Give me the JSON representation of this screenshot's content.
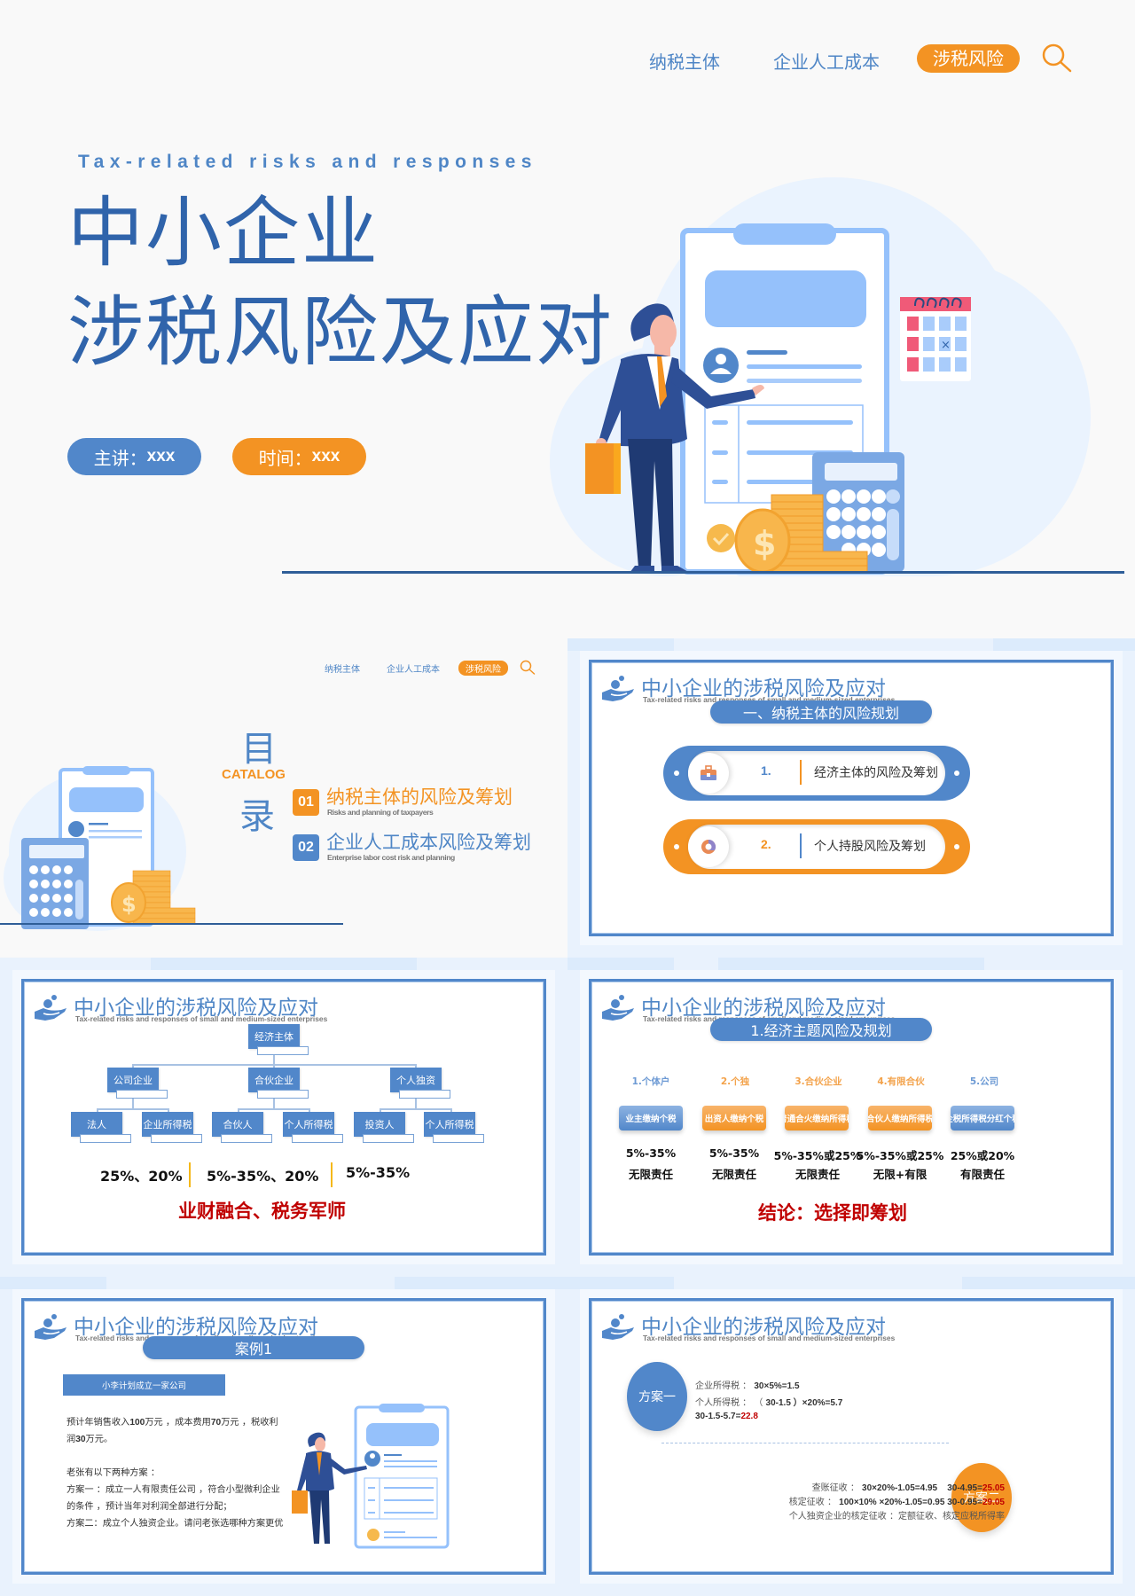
{
  "nav": {
    "items": [
      {
        "label": "纳税主体",
        "active": false
      },
      {
        "label": "企业人工成本",
        "active": false
      },
      {
        "label": "涉税风险",
        "active": true
      }
    ]
  },
  "hero": {
    "subtitle": "Tax-related risks and responses",
    "title_line1": "中小企业",
    "title_line2": "涉税风险及应对",
    "presenter_label": "主讲：",
    "presenter_value": "xxx",
    "time_label": "时间：",
    "time_value": "xxx"
  },
  "catalog": {
    "char_top": "目",
    "catalog_en": "CATALOG",
    "char_bottom": "录",
    "items": [
      {
        "num": "01",
        "title": "纳税主体的风险及筹划",
        "subtitle": "Risks and planning of taxpayers"
      },
      {
        "num": "02",
        "title": "企业人工成本风险及筹划",
        "subtitle": "Enterprise labor cost risk and planning"
      }
    ]
  },
  "slide_header": {
    "title": "中小企业的涉税风险及应对",
    "subtitle": "Tax-related risks and responses of small and medium-sized enterprises"
  },
  "slide2": {
    "banner": "一、纳税主体的风险规划",
    "items": [
      {
        "num": "1.",
        "label": "经济主体的风险及筹划",
        "icon": "toolbox-icon"
      },
      {
        "num": "2.",
        "label": "个人持股风险及筹划",
        "icon": "chrome-like-icon"
      }
    ]
  },
  "slide3": {
    "root": "经济主体",
    "branches": [
      {
        "label": "公司企业",
        "children": [
          "法人",
          "企业所得税"
        ]
      },
      {
        "label": "合伙企业",
        "children": [
          "合伙人",
          "个人所得税"
        ]
      },
      {
        "label": "个人独资",
        "children": [
          "投资人",
          "个人所得税"
        ]
      }
    ],
    "rates": [
      "25%、20%",
      "5%-35%、20%",
      "5%-35%"
    ],
    "conclusion": "业财融合、税务军师"
  },
  "slide4": {
    "banner": "1.经济主题风险及规划",
    "columns": [
      {
        "title": "1.个体户",
        "button": "业主缴纳个税",
        "rate": "5%-35%",
        "liability": "无限责任",
        "color": "blue"
      },
      {
        "title": "2.个独",
        "button": "出资人缴纳个税",
        "rate": "5%-35%",
        "liability": "无限责任",
        "color": "orange"
      },
      {
        "title": "3.合伙企业",
        "button": "普通合火缴纳所得税",
        "rate": "5%-35%或25%",
        "liability": "无限责任",
        "color": "orange"
      },
      {
        "title": "4.有限合伙",
        "button": "合伙人缴纳所得税",
        "rate": "5%-35%或25%",
        "liability": "无限+有限",
        "color": "orange"
      },
      {
        "title": "5.公司",
        "button": "企税所得税分红个税",
        "rate": "25%或20%",
        "liability": "有限责任",
        "color": "blue"
      }
    ],
    "conclusion": "结论：选择即筹划"
  },
  "slide5": {
    "banner": "案例1",
    "case_title": "小李计划成立一家公司",
    "para1_line1_a": "预计年销售收入",
    "para1_line1_b": "100",
    "para1_line1_c": "万元 ，成本费用",
    "para1_line1_d": "70",
    "para1_line1_e": "万元 ，税收利",
    "para1_line2_a": "润",
    "para1_line2_b": "30",
    "para1_line2_c": "万元。",
    "lines": [
      "老张有以下两种方案 ：",
      "方案一 ：成立一人有限责任公司 ，符合小型微利企业",
      "的条件 ，预计当年对利润全部进行分配；",
      "方案二：成立个人独资企业。请问老张选哪种方案更优"
    ]
  },
  "slide6": {
    "plan1": {
      "label": "方案一",
      "l1_label": "企业所得税 ： ",
      "l1_value": "30×5%=1.5",
      "l2_label": "个人所得税 ： （ ",
      "l2_value": "30-1.5",
      "l2_rest": " ）×20%=5.7",
      "l3_value": "30-1.5-5.7=",
      "l3_result": "22.8"
    },
    "plan2": {
      "label": "方案二",
      "l1_label": "查账征收 ： ",
      "l1_value": "30×20%-1.05=4.95    30-4.95=",
      "l1_result": "25.05",
      "l2_label": "核定征收 ： ",
      "l2_value": "100×10% ×20%-1.05=0.95 30-0.95=",
      "l2_result": "29.05",
      "l3": "个人独资企业的核定征收 ：定额征收、核定应税所得率"
    }
  },
  "colors": {
    "primary_blue": "#5187ca",
    "title_blue": "#3064ab",
    "accent_orange": "#f39323",
    "conclusion_red": "#c00000"
  }
}
